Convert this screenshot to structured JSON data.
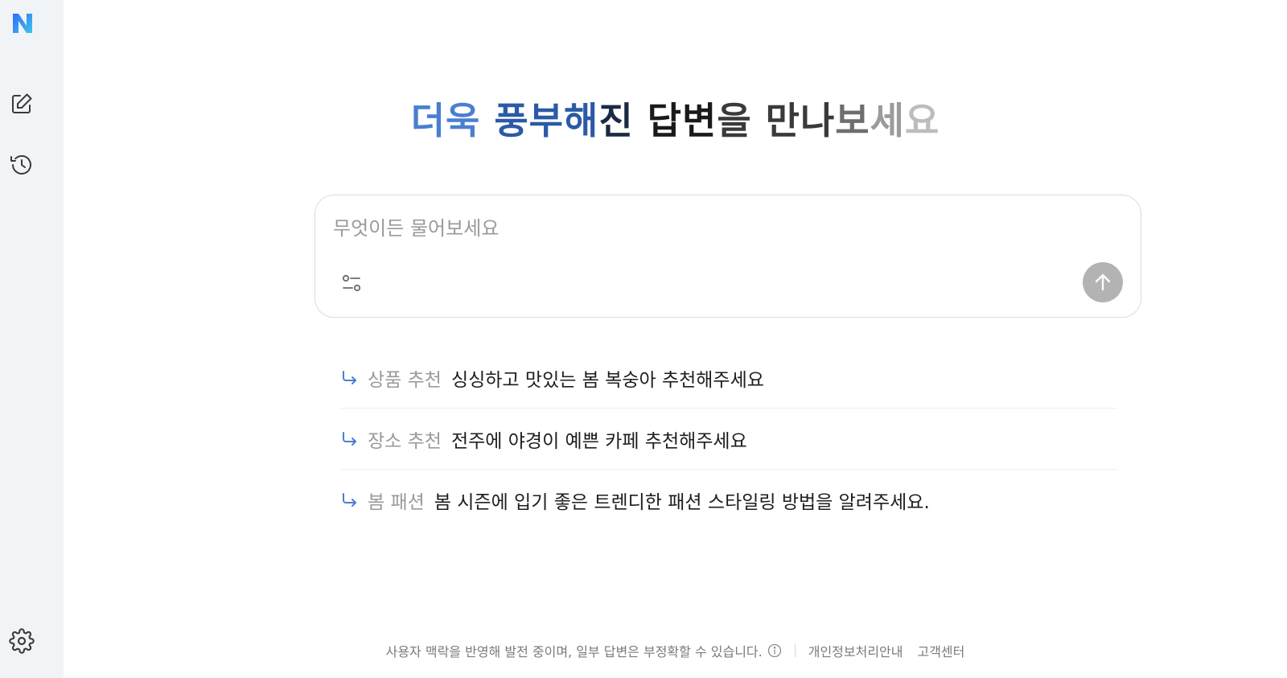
{
  "sidebar": {
    "logo_letter": "N",
    "items": [
      {
        "name": "new-chat",
        "icon": "edit-icon"
      },
      {
        "name": "history",
        "icon": "history-icon"
      },
      {
        "name": "settings",
        "icon": "gear-icon"
      }
    ]
  },
  "headline": {
    "parts": [
      "더욱 ",
      "풍부해",
      "진 ",
      "답변",
      "을 ",
      "만나",
      "보",
      "세",
      "요"
    ]
  },
  "input": {
    "placeholder": "무엇이든 물어보세요",
    "value": ""
  },
  "suggestions": [
    {
      "tag": "상품 추천",
      "text": "싱싱하고 맛있는 봄 복숭아 추천해주세요"
    },
    {
      "tag": "장소 추천",
      "text": "전주에 야경이 예쁜 카페 추천해주세요"
    },
    {
      "tag": "봄 패션",
      "text": "봄 시즌에 입기 좋은 트렌디한 패션 스타일링 방법을 알려주세요."
    }
  ],
  "footer": {
    "disclaimer": "사용자 맥락을 반영해 발전 중이며, 일부 답변은 부정확할 수 있습니다.",
    "privacy_link": "개인정보처리안내",
    "support_link": "고객센터"
  },
  "colors": {
    "accent_blue": "#4a7fd0",
    "sidebar_bg": "#f1f4f7",
    "send_button": "#b3b3b3"
  }
}
